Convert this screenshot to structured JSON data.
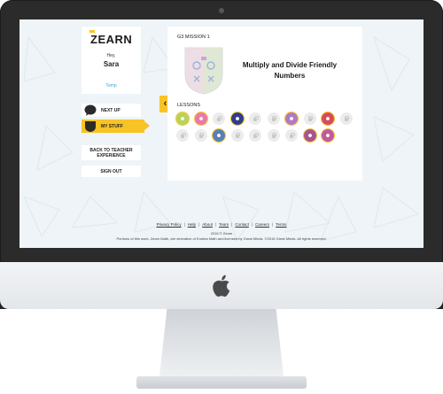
{
  "sidebar": {
    "brand": "ZEARN",
    "greeting": "Hey,",
    "username": "Sara",
    "temp_link": "Temp",
    "next_up": "NEXT UP",
    "my_stuff": "MY STUFF",
    "back_to_teacher_line1": "BACK TO TEACHER",
    "back_to_teacher_line2": "EXPERIENCE",
    "sign_out": "SIGN OUT"
  },
  "mission": {
    "label": "G3 MISSION 1",
    "title": "Multiply and Divide Friendly Numbers",
    "lessons_label": "LESSONS",
    "lessons": [
      {
        "state": "done",
        "color": "#b6d35a",
        "icon": "green-star-icon"
      },
      {
        "state": "done",
        "color": "#e87aa6",
        "icon": "pink-star-icon"
      },
      {
        "state": "locked",
        "icon": "lock-icon"
      },
      {
        "state": "done",
        "color": "#2f3d8a",
        "icon": "blue-star-icon"
      },
      {
        "state": "locked",
        "icon": "lock-icon"
      },
      {
        "state": "locked",
        "icon": "lock-icon"
      },
      {
        "state": "done",
        "color": "#b07ac4",
        "icon": "purple-star-icon"
      },
      {
        "state": "locked",
        "icon": "lock-icon"
      },
      {
        "state": "done",
        "color": "#d54b5c",
        "icon": "red-star-icon"
      },
      {
        "state": "locked",
        "icon": "lock-icon"
      },
      {
        "state": "locked",
        "icon": "lock-icon"
      },
      {
        "state": "locked",
        "icon": "lock-icon"
      },
      {
        "state": "done",
        "color": "#5b7fb5",
        "icon": "blue-star-icon"
      },
      {
        "state": "locked",
        "icon": "lock-icon"
      },
      {
        "state": "locked",
        "icon": "lock-icon"
      },
      {
        "state": "locked",
        "icon": "lock-icon"
      },
      {
        "state": "locked",
        "icon": "lock-icon"
      },
      {
        "state": "done",
        "color": "#a8548f",
        "icon": "purple-star-icon"
      },
      {
        "state": "done",
        "color": "#c05a9a",
        "icon": "pink-star-icon"
      }
    ]
  },
  "footer": {
    "links": [
      "Privacy Policy",
      "Help",
      "About",
      "Team",
      "Contact",
      "Careers",
      "Terms"
    ],
    "copyright_line1": "2016 © Zearn",
    "disclaimer": "Portions of this work, Zearn Math, are derivative of Eureka Math and licensed by Great Minds. ©2015 Great Minds. All rights reserved."
  },
  "colors": {
    "accent_yellow": "#f7c325",
    "link_blue": "#3aa7d8",
    "screen_bg": "#eef4f7",
    "bezel": "#2b2b2b"
  }
}
